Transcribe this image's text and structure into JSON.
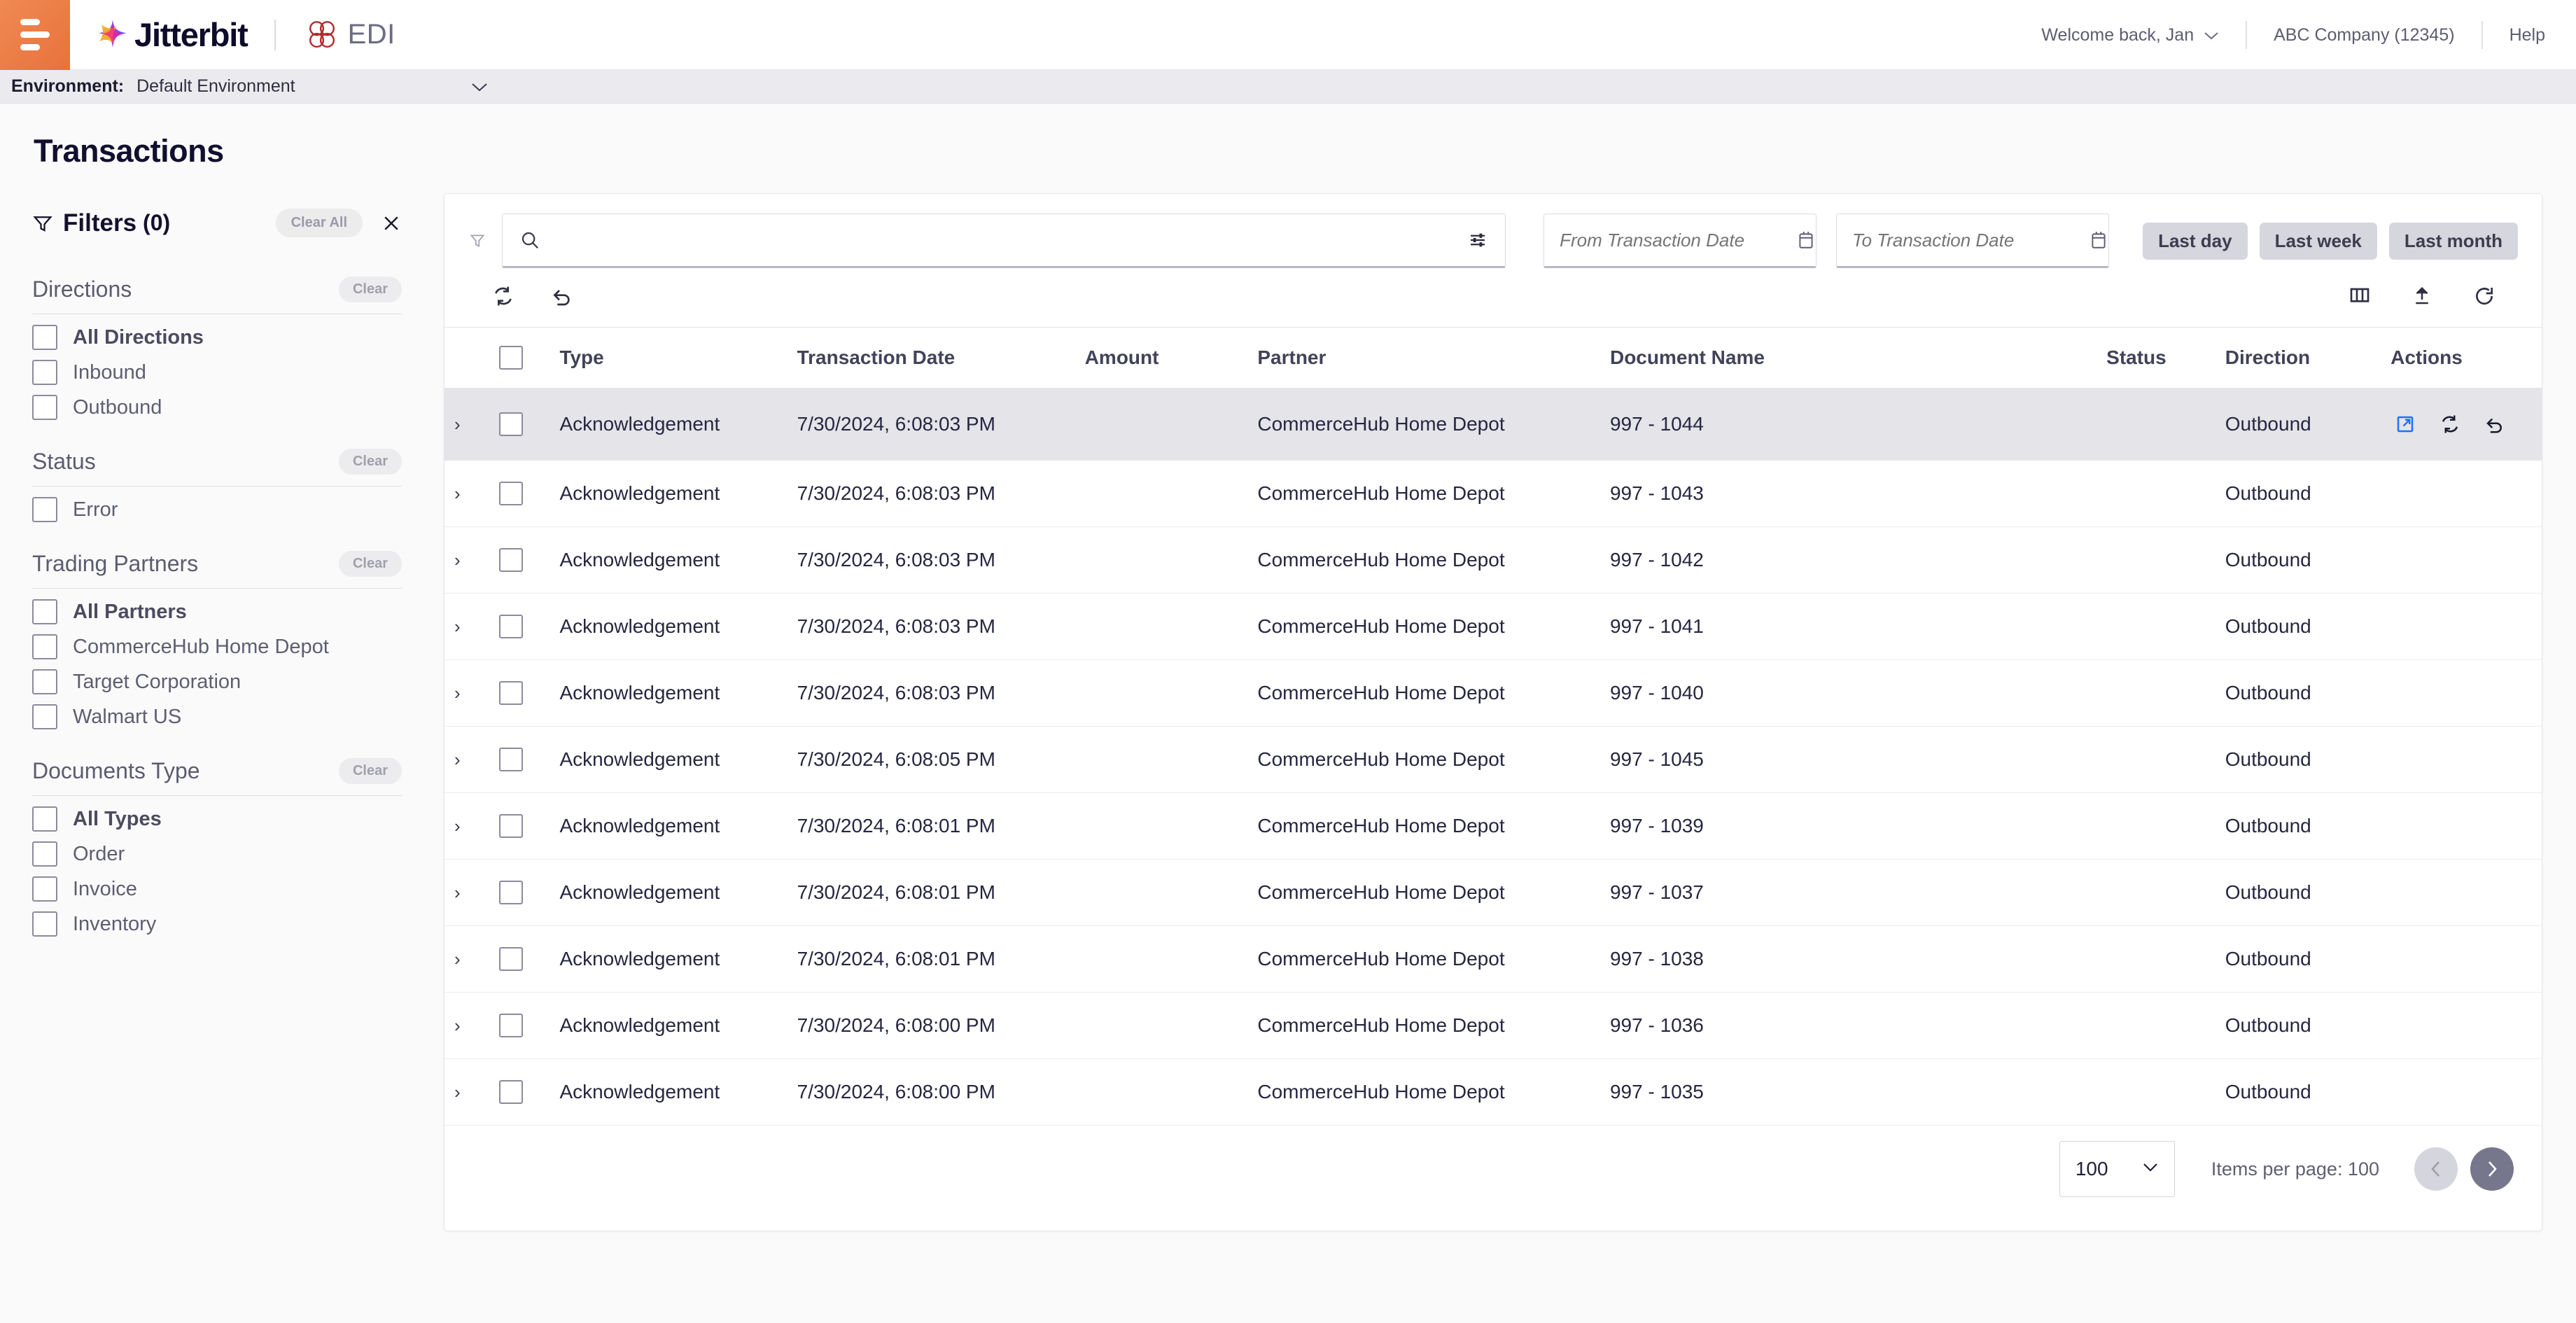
{
  "header": {
    "brand": "Jitterbit",
    "product": "EDI",
    "welcome": "Welcome back, Jan",
    "company": "ABC Company (12345)",
    "help": "Help",
    "menu_icon": "hamburger-icon",
    "brand_icon": "jitterbit-star-icon",
    "product_icon": "edi-clover-icon"
  },
  "environment": {
    "label": "Environment:",
    "value": "Default Environment"
  },
  "page": {
    "title": "Transactions"
  },
  "filters": {
    "title": "Filters",
    "count": "(0)",
    "clear_all": "Clear All",
    "close_icon": "close-icon",
    "funnel_icon": "filter-funnel-icon",
    "groups": [
      {
        "title": "Directions",
        "clear": "Clear",
        "options": [
          {
            "label": "All Directions",
            "bold": true,
            "checked": false
          },
          {
            "label": "Inbound",
            "bold": false,
            "checked": false
          },
          {
            "label": "Outbound",
            "bold": false,
            "checked": false
          }
        ]
      },
      {
        "title": "Status",
        "clear": "Clear",
        "options": [
          {
            "label": "Error",
            "bold": false,
            "checked": false
          }
        ]
      },
      {
        "title": "Trading Partners",
        "clear": "Clear",
        "options": [
          {
            "label": "All Partners",
            "bold": true,
            "checked": false
          },
          {
            "label": "CommerceHub Home Depot",
            "bold": false,
            "checked": false
          },
          {
            "label": "Target Corporation",
            "bold": false,
            "checked": false
          },
          {
            "label": "Walmart US",
            "bold": false,
            "checked": false
          }
        ]
      },
      {
        "title": "Documents Type",
        "clear": "Clear",
        "options": [
          {
            "label": "All Types",
            "bold": true,
            "checked": false
          },
          {
            "label": "Order",
            "bold": false,
            "checked": false
          },
          {
            "label": "Invoice",
            "bold": false,
            "checked": false
          },
          {
            "label": "Inventory",
            "bold": false,
            "checked": false
          }
        ]
      }
    ]
  },
  "toolbar": {
    "search_value": "",
    "search_placeholder": "",
    "search_icon": "search-icon",
    "sliders_icon": "sliders-settings-icon",
    "from_date_value": "",
    "from_date_placeholder": "From Transaction Date",
    "to_date_value": "",
    "to_date_placeholder": "To Transaction Date",
    "calendar_icon": "calendar-icon",
    "chips": [
      "Last day",
      "Last week",
      "Last month"
    ],
    "left_icons": [
      "sync-icon",
      "undo-icon"
    ],
    "right_icons": [
      "columns-icon",
      "export-upload-icon",
      "refresh-icon"
    ]
  },
  "table": {
    "columns": [
      "Type",
      "Transaction Date",
      "Amount",
      "Partner",
      "Document Name",
      "Status",
      "Direction",
      "Actions"
    ],
    "rows": [
      {
        "type": "Acknowledgement",
        "date": "7/30/2024, 6:08:03 PM",
        "amount": "",
        "partner": "CommerceHub Home Depot",
        "document": "997 - 1044",
        "status": "",
        "direction": "Outbound",
        "selected": true,
        "has_actions": true
      },
      {
        "type": "Acknowledgement",
        "date": "7/30/2024, 6:08:03 PM",
        "amount": "",
        "partner": "CommerceHub Home Depot",
        "document": "997 - 1043",
        "status": "",
        "direction": "Outbound",
        "selected": false,
        "has_actions": false
      },
      {
        "type": "Acknowledgement",
        "date": "7/30/2024, 6:08:03 PM",
        "amount": "",
        "partner": "CommerceHub Home Depot",
        "document": "997 - 1042",
        "status": "",
        "direction": "Outbound",
        "selected": false,
        "has_actions": false
      },
      {
        "type": "Acknowledgement",
        "date": "7/30/2024, 6:08:03 PM",
        "amount": "",
        "partner": "CommerceHub Home Depot",
        "document": "997 - 1041",
        "status": "",
        "direction": "Outbound",
        "selected": false,
        "has_actions": false
      },
      {
        "type": "Acknowledgement",
        "date": "7/30/2024, 6:08:03 PM",
        "amount": "",
        "partner": "CommerceHub Home Depot",
        "document": "997 - 1040",
        "status": "",
        "direction": "Outbound",
        "selected": false,
        "has_actions": false
      },
      {
        "type": "Acknowledgement",
        "date": "7/30/2024, 6:08:05 PM",
        "amount": "",
        "partner": "CommerceHub Home Depot",
        "document": "997 - 1045",
        "status": "",
        "direction": "Outbound",
        "selected": false,
        "has_actions": false
      },
      {
        "type": "Acknowledgement",
        "date": "7/30/2024, 6:08:01 PM",
        "amount": "",
        "partner": "CommerceHub Home Depot",
        "document": "997 - 1039",
        "status": "",
        "direction": "Outbound",
        "selected": false,
        "has_actions": false
      },
      {
        "type": "Acknowledgement",
        "date": "7/30/2024, 6:08:01 PM",
        "amount": "",
        "partner": "CommerceHub Home Depot",
        "document": "997 - 1037",
        "status": "",
        "direction": "Outbound",
        "selected": false,
        "has_actions": false
      },
      {
        "type": "Acknowledgement",
        "date": "7/30/2024, 6:08:01 PM",
        "amount": "",
        "partner": "CommerceHub Home Depot",
        "document": "997 - 1038",
        "status": "",
        "direction": "Outbound",
        "selected": false,
        "has_actions": false
      },
      {
        "type": "Acknowledgement",
        "date": "7/30/2024, 6:08:00 PM",
        "amount": "",
        "partner": "CommerceHub Home Depot",
        "document": "997 - 1036",
        "status": "",
        "direction": "Outbound",
        "selected": false,
        "has_actions": false
      },
      {
        "type": "Acknowledgement",
        "date": "7/30/2024, 6:08:00 PM",
        "amount": "",
        "partner": "CommerceHub Home Depot",
        "document": "997 - 1035",
        "status": "",
        "direction": "Outbound",
        "selected": false,
        "has_actions": false
      }
    ],
    "row_action_icons": [
      "open-external-icon",
      "reprocess-sync-icon",
      "revert-undo-icon"
    ]
  },
  "paginator": {
    "page_size_value": "100",
    "items_per_page_label": "Items per page: 100",
    "prev_icon": "chevron-left-icon",
    "next_icon": "chevron-right-icon"
  },
  "colors": {
    "accent_orange": "#e8713c",
    "action_blue": "#1a73ff",
    "selected_row": "#e4e4e9",
    "chip_bg": "#d6d6de"
  }
}
